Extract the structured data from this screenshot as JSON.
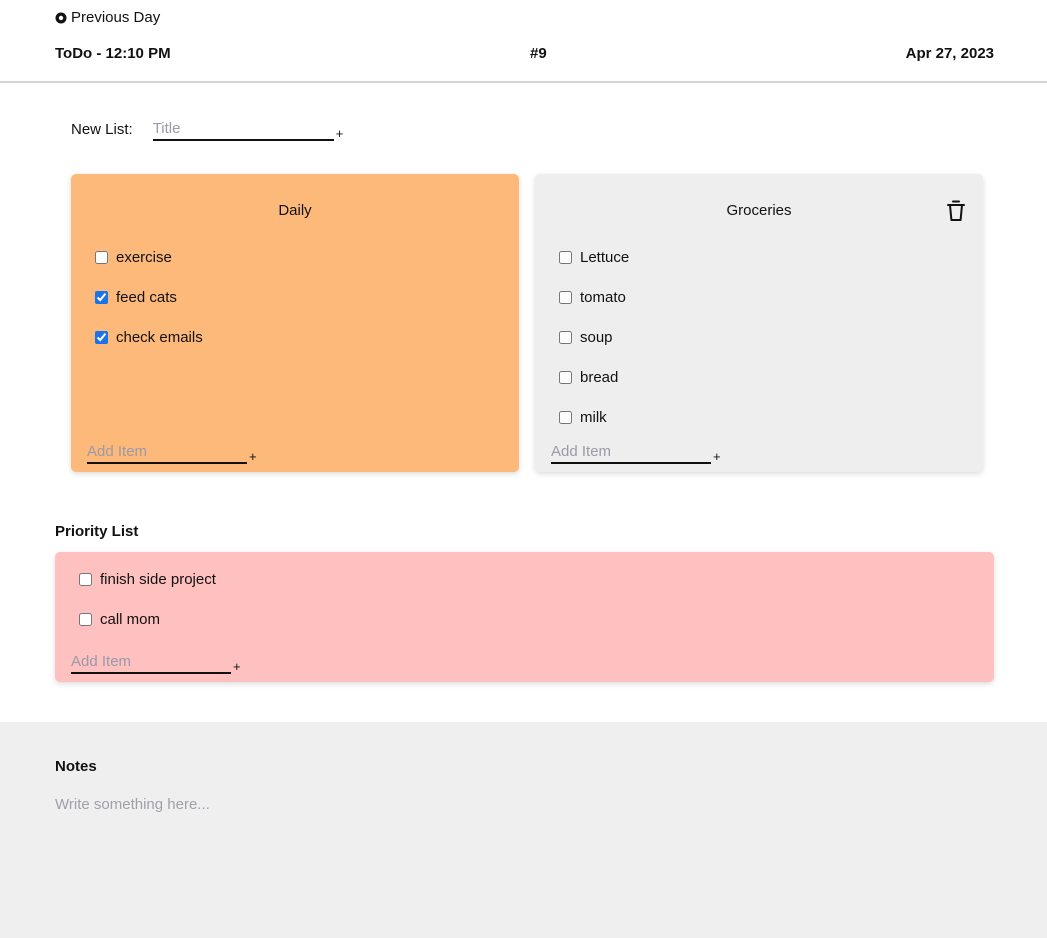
{
  "header": {
    "prev_day_label": "Previous Day",
    "title": "ToDo - 12:10 PM",
    "number": "#9",
    "date": "Apr 27, 2023"
  },
  "new_list": {
    "label": "New List:",
    "placeholder": "Title",
    "add_symbol": "+"
  },
  "lists": {
    "daily": {
      "title": "Daily",
      "color": "#fdb97a",
      "items": [
        {
          "label": "exercise",
          "checked": false
        },
        {
          "label": "feed cats",
          "checked": true
        },
        {
          "label": "check emails",
          "checked": true
        }
      ],
      "add_placeholder": "Add Item",
      "add_symbol": "+"
    },
    "groceries": {
      "title": "Groceries",
      "color": "#eeeeee",
      "delete_icon": "trash-icon",
      "items": [
        {
          "label": "Lettuce",
          "checked": false
        },
        {
          "label": "tomato",
          "checked": false
        },
        {
          "label": "soup",
          "checked": false
        },
        {
          "label": "bread",
          "checked": false
        },
        {
          "label": "milk",
          "checked": false
        }
      ],
      "add_placeholder": "Add Item",
      "add_symbol": "+"
    }
  },
  "priority": {
    "label": "Priority List",
    "color": "#ffc0c0",
    "items": [
      {
        "label": "finish side project",
        "checked": false
      },
      {
        "label": "call mom",
        "checked": false
      }
    ],
    "add_placeholder": "Add Item",
    "add_symbol": "+"
  },
  "notes": {
    "label": "Notes",
    "placeholder": "Write something here..."
  }
}
